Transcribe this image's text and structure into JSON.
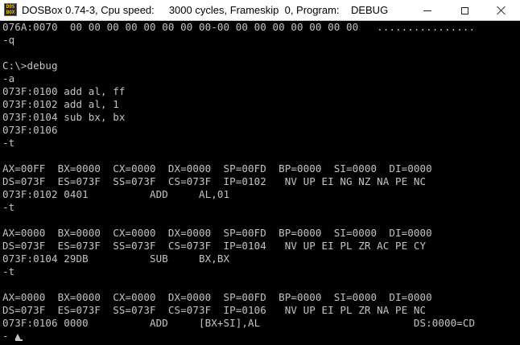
{
  "window": {
    "title": "DOSBox 0.74-3, Cpu speed:     3000 cycles, Frameskip  0, Program:    DEBUG",
    "icon": "dosbox-icon",
    "icon_text": "DOS\nBOX"
  },
  "console": {
    "text_color": "#c4c4c4",
    "background": "#000000",
    "lines": [
      "076A:0070  00 00 00 00 00 00 00 00-00 00 00 00 00 00 00 00   ................",
      "-q",
      "",
      "C:\\>debug",
      "-a",
      "073F:0100 add al, ff",
      "073F:0102 add al, 1",
      "073F:0104 sub bx, bx",
      "073F:0106",
      "-t",
      "",
      "AX=00FF  BX=0000  CX=0000  DX=0000  SP=00FD  BP=0000  SI=0000  DI=0000",
      "DS=073F  ES=073F  SS=073F  CS=073F  IP=0102   NV UP EI NG NZ NA PE NC",
      "073F:0102 0401          ADD     AL,01",
      "-t",
      "",
      "AX=0000  BX=0000  CX=0000  DX=0000  SP=00FD  BP=0000  SI=0000  DI=0000",
      "DS=073F  ES=073F  SS=073F  CS=073F  IP=0104   NV UP EI PL ZR AC PE CY",
      "073F:0104 29DB          SUB     BX,BX",
      "-t",
      "",
      "AX=0000  BX=0000  CX=0000  DX=0000  SP=00FD  BP=0000  SI=0000  DI=0000",
      "DS=073F  ES=073F  SS=073F  CS=073F  IP=0106   NV UP EI PL ZR NA PE NC",
      "073F:0106 0000          ADD     [BX+SI],AL                         DS:0000=CD",
      "- ▲"
    ]
  }
}
